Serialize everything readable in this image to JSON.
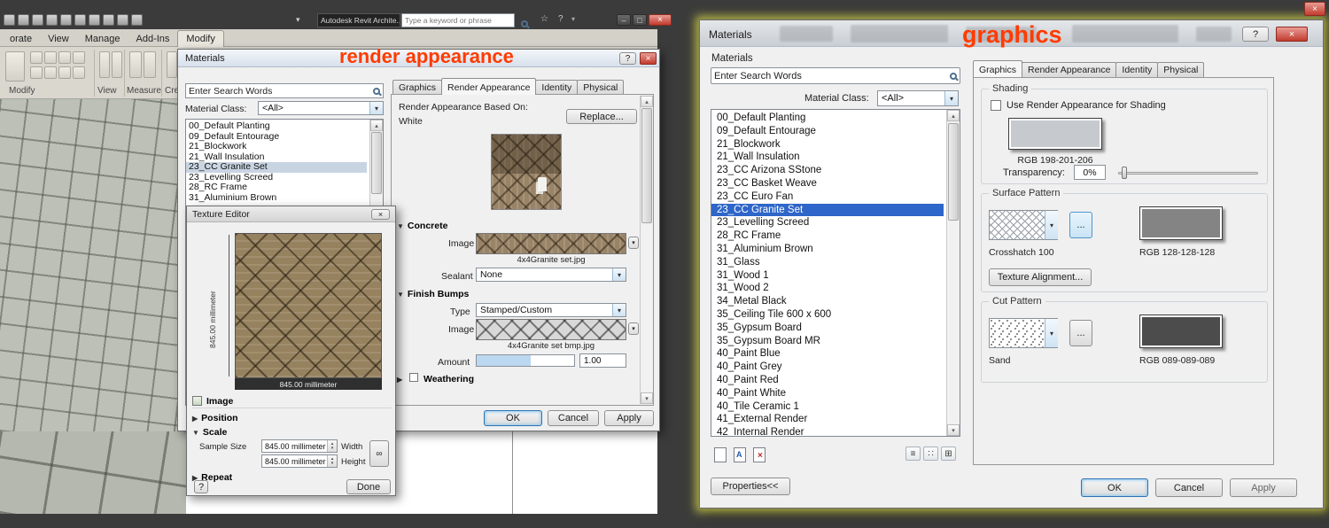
{
  "overlays": {
    "left_label": "render appearance",
    "right_label": "graphics"
  },
  "colors": {
    "shading_swatch": "#c6c9ce",
    "surface_swatch": "#848484",
    "cut_swatch": "#4c4c4c",
    "selection_blue": "#2e66c9",
    "overlay_red": "#ff3b00"
  },
  "icons": {
    "dropdown": "▾",
    "spin_up": "▴",
    "spin_down": "▾",
    "expanded": "▼",
    "collapsed": "▶",
    "close": "×",
    "help": "?",
    "minimize": "–",
    "maximize": "□",
    "star": "☆",
    "link": "∞",
    "asset_a": "A",
    "list_view": "≡",
    "small_icons_view": "∷",
    "large_icons_view": "⊞",
    "scroll_up": "▴",
    "scroll_down": "▾"
  },
  "revit": {
    "app_title": "Autodesk Revit Archite...",
    "help_search_placeholder": "Type a keyword or phrase",
    "ribbon_tabs": [
      "orate",
      "View",
      "Manage",
      "Add-Ins",
      "Modify"
    ],
    "active_ribbon_tab": "Modify",
    "ribbon_group_labels": [
      "Modify",
      "View",
      "Measure",
      "Creat"
    ]
  },
  "left_dialog": {
    "title": "Materials",
    "search_value": "Enter Search Words",
    "material_class_label": "Material Class:",
    "material_class_value": "<All>",
    "materials": [
      "00_Default Planting",
      "09_Default Entourage",
      "21_Blockwork",
      "21_Wall Insulation",
      "23_CC Granite Set",
      "23_Levelling Screed",
      "28_RC Frame",
      "31_Aluminium Brown"
    ],
    "selected_material": "23_CC Granite Set",
    "tabs": [
      "Graphics",
      "Render Appearance",
      "Identity",
      "Physical"
    ],
    "active_tab": "Render Appearance",
    "based_on_label": "Render Appearance Based On:",
    "based_on_value": "White",
    "replace_button": "Replace...",
    "concrete": {
      "title": "Concrete",
      "image_label": "Image",
      "image_file": "4x4Granite set.jpg",
      "sealant_label": "Sealant",
      "sealant_value": "None"
    },
    "finish_bumps": {
      "title": "Finish Bumps",
      "type_label": "Type",
      "type_value": "Stamped/Custom",
      "image_label": "Image",
      "image_file": "4x4Granite set  bmp.jpg",
      "amount_label": "Amount",
      "amount_value": "1.00"
    },
    "weathering_title": "Weathering",
    "ok": "OK",
    "cancel": "Cancel",
    "apply": "Apply"
  },
  "texture_editor": {
    "title": "Texture Editor",
    "ruler_vertical": "845.00 millimeter",
    "ruler_horizontal": "845.00 millimeter",
    "image_section": "Image",
    "position_section": "Position",
    "scale_section": "Scale",
    "sample_size_label": "Sample Size",
    "width_value": "845.00 millimeter",
    "width_label": "Width",
    "height_value": "845.00 millimeter",
    "height_label": "Height",
    "repeat_section": "Repeat",
    "help_button": "?",
    "done_button": "Done"
  },
  "right_dialog": {
    "title": "Materials",
    "panel_label": "Materials",
    "search_value": "Enter Search Words",
    "material_class_label": "Material Class:",
    "material_class_value": "<All>",
    "materials": [
      "00_Default Planting",
      "09_Default Entourage",
      "21_Blockwork",
      "21_Wall Insulation",
      "23_CC Arizona SStone",
      "23_CC Basket Weave",
      "23_CC Euro Fan",
      "23_CC Granite Set",
      "23_Levelling Screed",
      "28_RC Frame",
      "31_Aluminium Brown",
      "31_Glass",
      "31_Wood 1",
      "31_Wood 2",
      "34_Metal Black",
      "35_Ceiling Tile 600 x 600",
      "35_Gypsum Board",
      "35_Gypsum Board MR",
      "40_Paint Blue",
      "40_Paint Grey",
      "40_Paint Red",
      "40_Paint White",
      "40_Tile Ceramic 1",
      "41_External Render",
      "42_Internal Render"
    ],
    "selected_material": "23_CC Granite Set",
    "tabs": [
      "Graphics",
      "Render Appearance",
      "Identity",
      "Physical"
    ],
    "active_tab": "Graphics",
    "shading": {
      "title": "Shading",
      "checkbox_label": "Use Render Appearance for Shading",
      "rgb_label": "RGB 198-201-206",
      "transparency_label": "Transparency:",
      "transparency_value": "0%"
    },
    "surface_pattern": {
      "title": "Surface Pattern",
      "name": "Crosshatch 100",
      "rgb_label": "RGB 128-128-128",
      "browse_button": "...",
      "texture_alignment_button": "Texture Alignment..."
    },
    "cut_pattern": {
      "title": "Cut Pattern",
      "name": "Sand",
      "rgb_label": "RGB 089-089-089",
      "browse_button": "..."
    },
    "properties_button": "Properties<<",
    "ok": "OK",
    "cancel": "Cancel",
    "apply": "Apply"
  }
}
